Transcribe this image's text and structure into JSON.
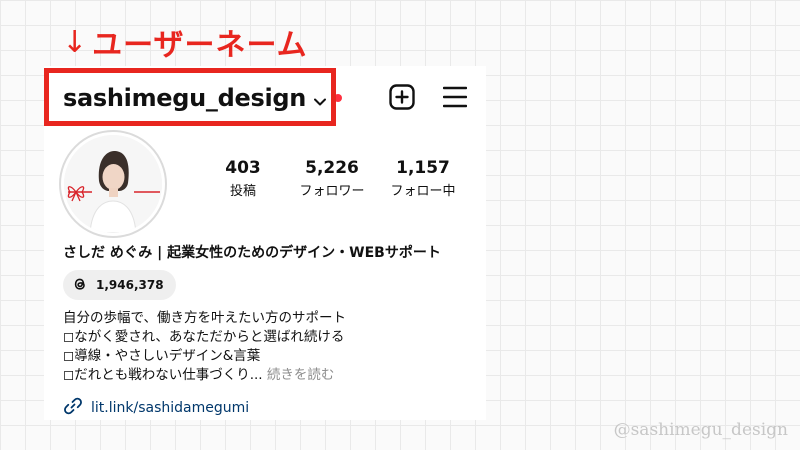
{
  "annotation": {
    "arrow": "↓",
    "text": "ユーザーネーム"
  },
  "profile": {
    "username": "sashimegu_design",
    "stats": [
      {
        "value": "403",
        "label": "投稿"
      },
      {
        "value": "5,226",
        "label": "フォロワー"
      },
      {
        "value": "1,157",
        "label": "フォロー中"
      }
    ],
    "display_name": "さしだ めぐみ | 起業女性のためのデザイン・WEBサポート",
    "threads_count": "1,946,378",
    "bio": [
      "自分の歩幅で、働き方を叶えたい方のサポート",
      "◻︎ながく愛され、あなただからと選ばれ続ける",
      "◻︎導線・やさしいデザイン&言葉",
      "◻︎だれとも戦わない仕事づくり..."
    ],
    "more_label": "続きを読む",
    "link": "lit.link/sashidamegumi"
  },
  "icons": {
    "username_dropdown": "chevron-down-icon",
    "new_post": "plus-square-icon",
    "menu": "hamburger-menu-icon",
    "threads": "threads-icon",
    "link": "link-icon"
  },
  "colors": {
    "accent": "#e8261f",
    "notification_dot": "#ff3040",
    "link": "#00376b"
  },
  "watermark": "@sashimegu_design"
}
